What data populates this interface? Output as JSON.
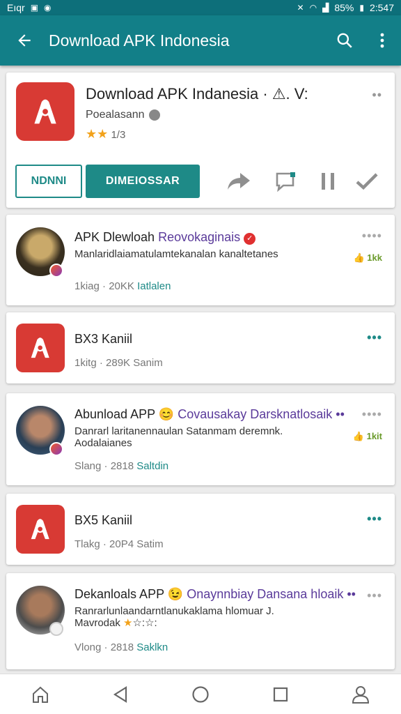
{
  "status_bar": {
    "carrier": "Eıqr",
    "battery": "85%",
    "time": "2:547"
  },
  "app_bar": {
    "title": "Download APK Indonesia"
  },
  "app_card": {
    "title": "Download APK Indanesia · ⚠. V:",
    "subtitle": "Poealasann",
    "rating_stars": "★★",
    "rating_text": "1/3",
    "rating_value": 2,
    "more": "••",
    "btn_outline": "NDNNI",
    "btn_primary": "DIMEIOSSAR",
    "brand_color": "#d83a34",
    "accent_color": "#1e8a87"
  },
  "posts": [
    {
      "type": "user",
      "name": "APK Dlewloah",
      "handle": "Reovokaginais",
      "verified": true,
      "text": "Manlaridlaiamatulamtekanalan kanaltetanes",
      "meta_time": "1kiag · 20KK",
      "meta_action": "Iatlalen",
      "more": "••••",
      "like": "👍 1kk"
    },
    {
      "type": "app",
      "name": "BX3 Kaniil",
      "meta_time": "1kitg · 289K",
      "meta_action": "Sanim",
      "more": "•••"
    },
    {
      "type": "user",
      "name": "Abunload APP 😊",
      "handle": "Covausakay Darsknatlosaik ••",
      "text": "Danrarl laritanennaulan Satanmam deremnk. Aodalaianes",
      "meta_time": "Slang · 2818",
      "meta_action": "Saltdin",
      "more": "••••",
      "like": "👍 1kit"
    },
    {
      "type": "app",
      "name": "BX5 Kaniil",
      "meta_time": "Tlakg · 20P4",
      "meta_action": "Satim",
      "more": "•••"
    },
    {
      "type": "user",
      "name": "Dekanloals APP 😉",
      "handle": "Onaynnbiay Dansana hloaik ••",
      "text": "Ranrarlunlaandarntlanukaklama hlomuar J.",
      "text2_prefix": "Mavrodak",
      "text2_stars": "★",
      "text2_rest": "☆:☆:",
      "meta_time": "Vlong · 2818",
      "meta_action": "Saklkn",
      "more": "•••"
    }
  ],
  "nav": {
    "home": "home-icon",
    "back": "back-triangle-icon",
    "circle": "home-circle-icon",
    "recents": "recents-square-icon",
    "profile": "profile-icon"
  }
}
